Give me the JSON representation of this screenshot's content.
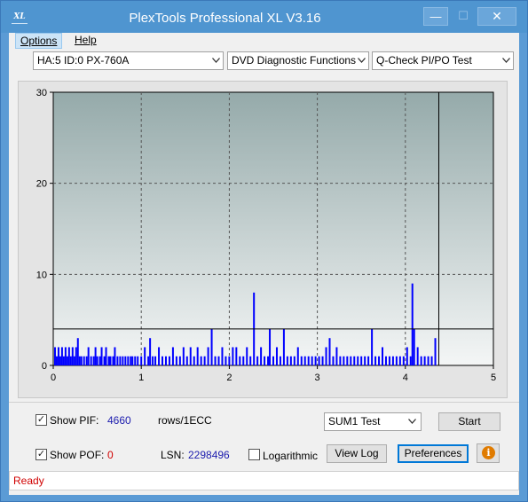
{
  "window": {
    "title": "PlexTools Professional XL V3.16",
    "icon_text": "XL",
    "minimize_glyph": "—",
    "maximize_glyph": "☐",
    "close_glyph": "✕"
  },
  "menu": {
    "items": [
      {
        "label": "Options"
      },
      {
        "label": "Help"
      }
    ]
  },
  "toolbar": {
    "drive_select": "HA:5 ID:0  PX-760A",
    "function_select": "DVD Diagnostic Functions",
    "test_select": "Q-Check PI/PO Test"
  },
  "chart_data": {
    "type": "bar",
    "x_ticks": [
      "0",
      "1",
      "2",
      "3",
      "4",
      "5"
    ],
    "y_ticks": [
      "0",
      "10",
      "20",
      "30"
    ],
    "xlim": [
      0,
      5
    ],
    "ylim": [
      0,
      30
    ],
    "grid": true,
    "threshold_line": 4,
    "end_marker_x": 4.38,
    "series": [
      {
        "color": "#0000ff",
        "points": [
          [
            0.02,
            2
          ],
          [
            0.04,
            1
          ],
          [
            0.06,
            2
          ],
          [
            0.08,
            1
          ],
          [
            0.1,
            2
          ],
          [
            0.12,
            1
          ],
          [
            0.14,
            2
          ],
          [
            0.16,
            1
          ],
          [
            0.18,
            2
          ],
          [
            0.2,
            1
          ],
          [
            0.22,
            2
          ],
          [
            0.24,
            1
          ],
          [
            0.26,
            2
          ],
          [
            0.28,
            3
          ],
          [
            0.3,
            1
          ],
          [
            0.32,
            1
          ],
          [
            0.35,
            1
          ],
          [
            0.38,
            1
          ],
          [
            0.4,
            2
          ],
          [
            0.43,
            1
          ],
          [
            0.46,
            1
          ],
          [
            0.48,
            2
          ],
          [
            0.5,
            1
          ],
          [
            0.53,
            1
          ],
          [
            0.55,
            2
          ],
          [
            0.58,
            1
          ],
          [
            0.6,
            2
          ],
          [
            0.63,
            1
          ],
          [
            0.65,
            1
          ],
          [
            0.68,
            1
          ],
          [
            0.7,
            2
          ],
          [
            0.73,
            1
          ],
          [
            0.76,
            1
          ],
          [
            0.79,
            1
          ],
          [
            0.82,
            1
          ],
          [
            0.85,
            1
          ],
          [
            0.88,
            1
          ],
          [
            0.9,
            1
          ],
          [
            0.93,
            1
          ],
          [
            0.96,
            1
          ],
          [
            1.0,
            1
          ],
          [
            1.04,
            2
          ],
          [
            1.08,
            1
          ],
          [
            1.1,
            3
          ],
          [
            1.13,
            1
          ],
          [
            1.16,
            1
          ],
          [
            1.2,
            2
          ],
          [
            1.24,
            1
          ],
          [
            1.28,
            1
          ],
          [
            1.32,
            1
          ],
          [
            1.36,
            2
          ],
          [
            1.4,
            1
          ],
          [
            1.44,
            1
          ],
          [
            1.48,
            2
          ],
          [
            1.52,
            1
          ],
          [
            1.56,
            2
          ],
          [
            1.6,
            1
          ],
          [
            1.64,
            2
          ],
          [
            1.68,
            1
          ],
          [
            1.72,
            1
          ],
          [
            1.76,
            2
          ],
          [
            1.8,
            4
          ],
          [
            1.84,
            1
          ],
          [
            1.88,
            1
          ],
          [
            1.92,
            2
          ],
          [
            1.96,
            1
          ],
          [
            2.0,
            1
          ],
          [
            2.04,
            2
          ],
          [
            2.08,
            2
          ],
          [
            2.12,
            1
          ],
          [
            2.16,
            1
          ],
          [
            2.2,
            2
          ],
          [
            2.24,
            1
          ],
          [
            2.28,
            8
          ],
          [
            2.32,
            1
          ],
          [
            2.36,
            2
          ],
          [
            2.4,
            1
          ],
          [
            2.44,
            1
          ],
          [
            2.46,
            4
          ],
          [
            2.5,
            1
          ],
          [
            2.54,
            2
          ],
          [
            2.58,
            1
          ],
          [
            2.62,
            4
          ],
          [
            2.66,
            1
          ],
          [
            2.7,
            1
          ],
          [
            2.74,
            1
          ],
          [
            2.78,
            2
          ],
          [
            2.82,
            1
          ],
          [
            2.86,
            1
          ],
          [
            2.9,
            1
          ],
          [
            2.94,
            1
          ],
          [
            2.98,
            1
          ],
          [
            3.02,
            1
          ],
          [
            3.06,
            1
          ],
          [
            3.1,
            2
          ],
          [
            3.14,
            3
          ],
          [
            3.18,
            1
          ],
          [
            3.22,
            2
          ],
          [
            3.26,
            1
          ],
          [
            3.3,
            1
          ],
          [
            3.34,
            1
          ],
          [
            3.38,
            1
          ],
          [
            3.42,
            1
          ],
          [
            3.46,
            1
          ],
          [
            3.5,
            1
          ],
          [
            3.54,
            1
          ],
          [
            3.58,
            1
          ],
          [
            3.62,
            4
          ],
          [
            3.66,
            1
          ],
          [
            3.7,
            1
          ],
          [
            3.74,
            2
          ],
          [
            3.78,
            1
          ],
          [
            3.82,
            1
          ],
          [
            3.86,
            1
          ],
          [
            3.9,
            1
          ],
          [
            3.94,
            1
          ],
          [
            3.98,
            1
          ],
          [
            4.02,
            2
          ],
          [
            4.06,
            1
          ],
          [
            4.08,
            9
          ],
          [
            4.1,
            4
          ],
          [
            4.14,
            2
          ],
          [
            4.18,
            1
          ],
          [
            4.22,
            1
          ],
          [
            4.26,
            1
          ],
          [
            4.3,
            1
          ],
          [
            4.34,
            3
          ]
        ]
      }
    ]
  },
  "bottom": {
    "show_pif_label": "Show PIF:",
    "show_pif_checked": true,
    "pif_value": "4660",
    "rows_label": "rows/1ECC",
    "sum_select": "SUM1 Test",
    "start_label": "Start",
    "show_pof_label": "Show POF:",
    "show_pof_checked": true,
    "pof_value": "0",
    "lsn_label": "LSN:",
    "lsn_value": "2298496",
    "log_label": "Logarithmic",
    "log_checked": false,
    "view_log_label": "View Log",
    "preferences_label": "Preferences",
    "info_glyph": "i"
  },
  "status": {
    "text": "Ready"
  }
}
